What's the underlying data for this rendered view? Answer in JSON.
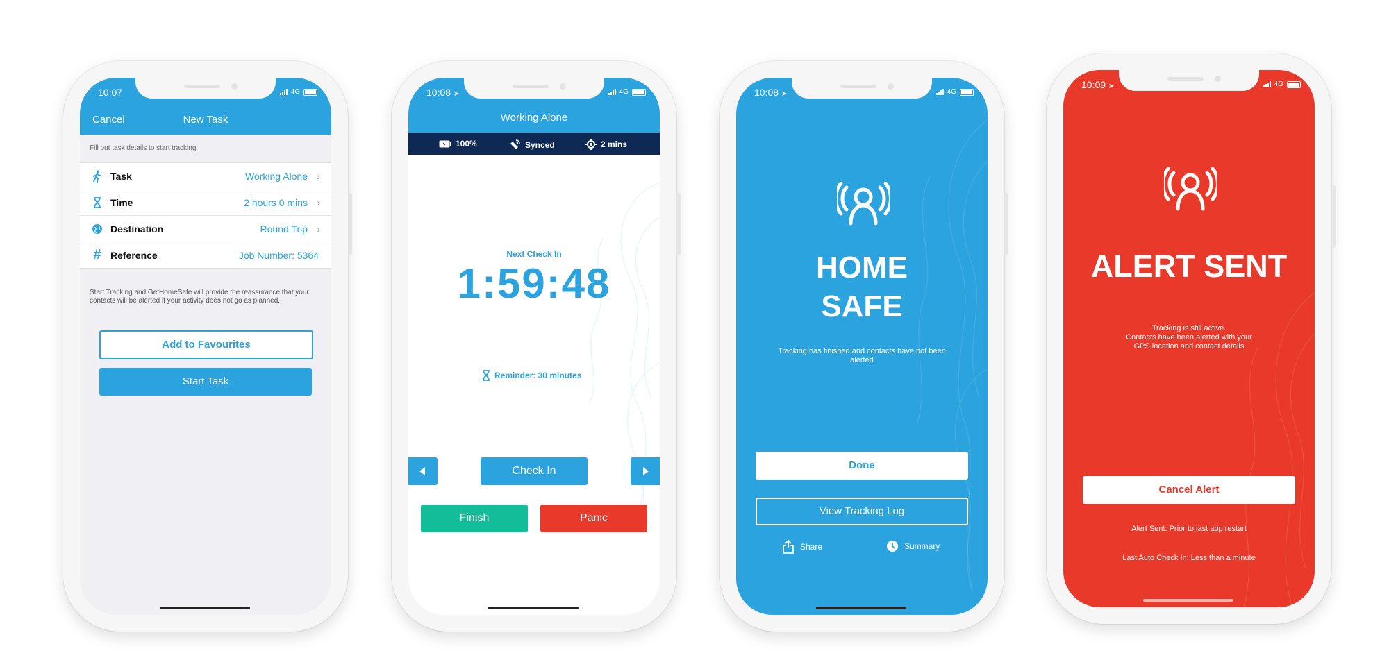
{
  "phone1": {
    "status": {
      "time": "10:07",
      "network": "4G"
    },
    "nav": {
      "cancel": "Cancel",
      "title": "New Task"
    },
    "instructions": "Fill out task details to start tracking",
    "rows": [
      {
        "icon": "walking-person-icon",
        "label": "Task",
        "value": "Working Alone"
      },
      {
        "icon": "hourglass-icon",
        "label": "Time",
        "value": "2 hours 0 mins"
      },
      {
        "icon": "globe-icon",
        "label": "Destination",
        "value": "Round Trip"
      },
      {
        "icon": "hash-icon",
        "label": "Reference",
        "value": "Job Number: 5364"
      }
    ],
    "note": "Start Tracking and GetHomeSafe will provide the reassurance that your contacts will be alerted if your activity does not go as planned.",
    "add_favourites": "Add to Favourites",
    "start_task": "Start Task"
  },
  "phone2": {
    "status": {
      "time": "10:08",
      "network": "4G"
    },
    "title": "Working Alone",
    "strip": {
      "battery": "100%",
      "sync": "Synced",
      "location": "2 mins"
    },
    "next_label": "Next Check In",
    "timer": "1:59:48",
    "reminder": "Reminder: 30 minutes",
    "check_in": "Check In",
    "finish": "Finish",
    "panic": "Panic"
  },
  "phone3": {
    "status": {
      "time": "10:08",
      "network": "4G"
    },
    "heading_line1": "HOME",
    "heading_line2": "SAFE",
    "message": "Tracking has finished and contacts have not been alerted",
    "done": "Done",
    "view_log": "View Tracking Log",
    "share": "Share",
    "summary": "Summary"
  },
  "phone4": {
    "status": {
      "time": "10:09",
      "network": "4G"
    },
    "heading": "ALERT SENT",
    "message_line1": "Tracking is still active.",
    "message_line2": "Contacts have been alerted with your",
    "message_line3": "GPS location and contact details",
    "cancel_alert": "Cancel Alert",
    "alert_sent": "Alert Sent: Prior to last app restart",
    "last_check_in": "Last Auto Check In: Less than a minute"
  },
  "colors": {
    "brand_blue": "#2ba3de",
    "navy": "#0e2a54",
    "green": "#13bd99",
    "red": "#e8392a"
  }
}
